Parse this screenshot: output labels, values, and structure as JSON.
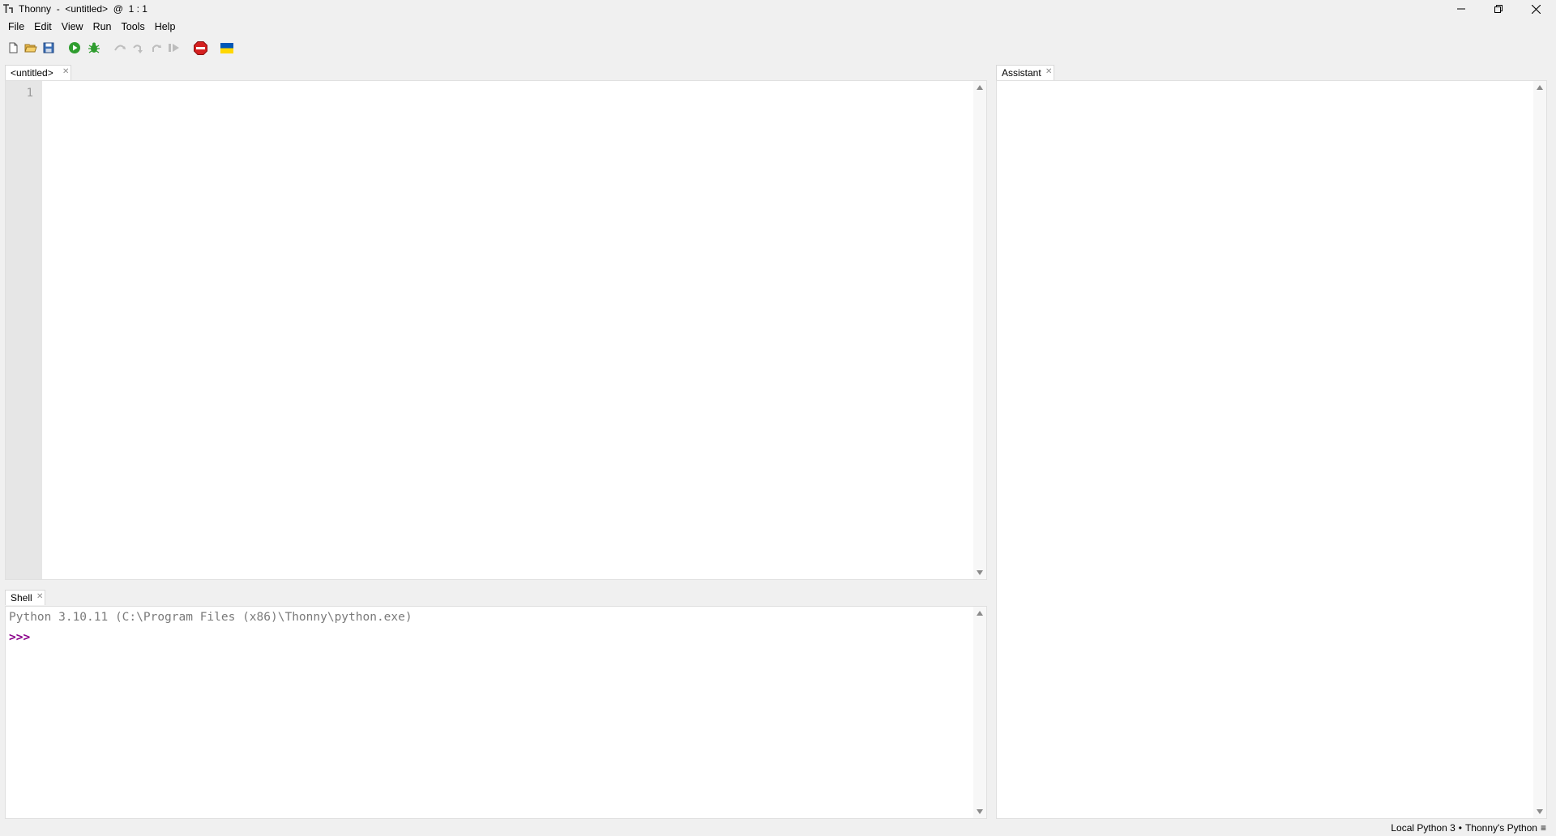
{
  "window": {
    "title": "Thonny  -  <untitled>  @  1 : 1"
  },
  "menu": [
    "File",
    "Edit",
    "View",
    "Run",
    "Tools",
    "Help"
  ],
  "toolbar": {
    "icons": [
      "new-file-icon",
      "open-file-icon",
      "save-file-icon",
      "run-icon",
      "debug-icon",
      "step-over-icon",
      "step-into-icon",
      "step-out-icon",
      "resume-icon",
      "stop-icon",
      "ukraine-flag-icon"
    ],
    "colors": {
      "run": "#2f9d2f",
      "stop": "#d42020",
      "flag_blue": "#0057b7",
      "flag_yellow": "#ffd700"
    }
  },
  "editor": {
    "tab_label": "<untitled>",
    "line_numbers": [
      "1"
    ]
  },
  "shell": {
    "tab_label": "Shell",
    "banner": "Python 3.10.11 (C:\\Program Files (x86)\\Thonny\\python.exe)",
    "prompt": ">>>"
  },
  "assistant": {
    "tab_label": "Assistant"
  },
  "statusbar": {
    "interpreter": "Local Python 3",
    "separator": "•",
    "backend": "Thonny's Python",
    "menu_glyph": "≡"
  }
}
